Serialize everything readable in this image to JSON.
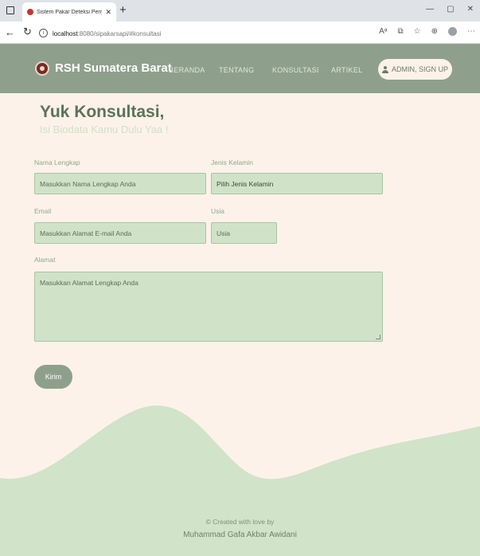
{
  "browser": {
    "tab_title": "Sistem Pakar Deteksi Penyakit Sa",
    "url_host": "localhost",
    "url_path": ":8080/sipakarsapi/#konsultasi"
  },
  "navbar": {
    "brand": "RSH Sumatera Barat",
    "links": [
      "BERANDA",
      "TENTANG",
      "KONSULTASI",
      "ARTIKEL"
    ],
    "admin_button": "ADMIN, SIGN UP"
  },
  "form": {
    "title": "Yuk Konsultasi,",
    "subtitle": "Isi Biodata Kamu Dulu Yaa !",
    "name": {
      "label": "Nama Lengkap",
      "placeholder": "Masukkan Nama Lengkap Anda"
    },
    "gender": {
      "label": "Jenis Kelamin",
      "selected": "Pilih Jenis Kelamin"
    },
    "email": {
      "label": "Email",
      "placeholder": "Masukkan Alamat E-mail Anda"
    },
    "age": {
      "label": "Usia",
      "placeholder": "Usia"
    },
    "address": {
      "label": "Alamat",
      "placeholder": "Masukkan Alamat Lengkap Anda"
    },
    "submit": "Kirim"
  },
  "footer": {
    "credit": "© Created with love by",
    "author": "Muhammad Gafa Akbar Awidani"
  },
  "colors": {
    "accent": "#8ea08b",
    "field_bg": "#d0e3c8",
    "page_bg": "#fdf2ea"
  }
}
